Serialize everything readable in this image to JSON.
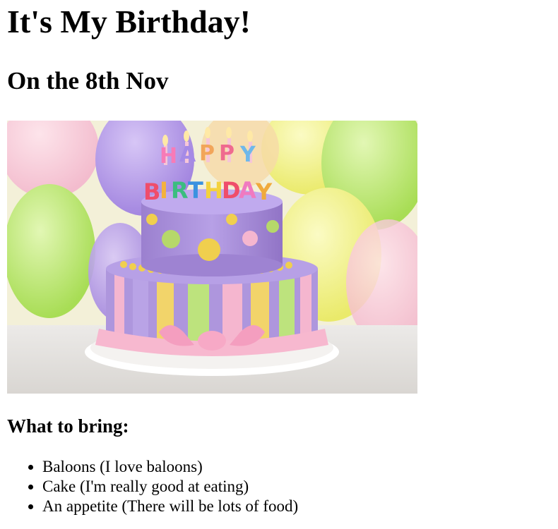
{
  "page": {
    "title": "It's My Birthday!",
    "subtitle": "On the 8th Nov",
    "image": {
      "icon": "birthday-cake-photo",
      "cake_lettering": "HAPPY BIRTHDAY"
    },
    "list_heading": "What to bring:",
    "items": [
      "Baloons (I love baloons)",
      "Cake (I'm really good at eating)",
      "An appetite (There will be lots of food)"
    ]
  },
  "colors": {
    "text": "#000000",
    "background": "#ffffff",
    "cake_purple": "#a98fd6",
    "cake_pink": "#f5b6cf",
    "balloon_yellow": "#f2f27a",
    "balloon_purple": "#b49ae8",
    "balloon_green": "#bde86a"
  }
}
